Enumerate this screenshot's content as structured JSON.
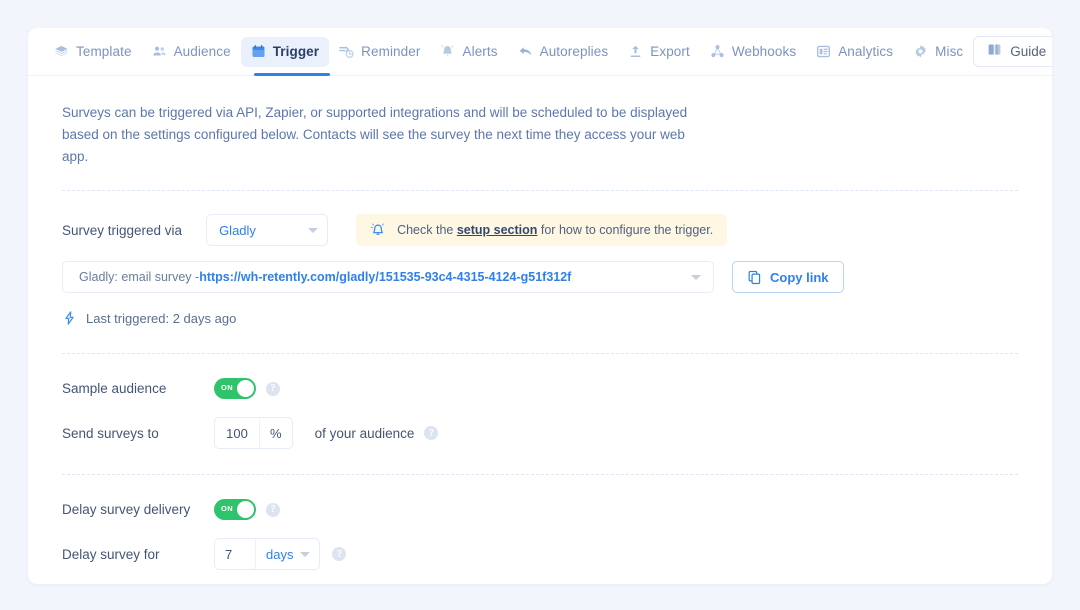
{
  "tabs": [
    {
      "label": "Template",
      "icon": "layers-icon",
      "active": false
    },
    {
      "label": "Audience",
      "icon": "people-icon",
      "active": false
    },
    {
      "label": "Trigger",
      "icon": "calendar-icon",
      "active": true
    },
    {
      "label": "Reminder",
      "icon": "clock-arrow-icon",
      "active": false
    },
    {
      "label": "Alerts",
      "icon": "bell-icon",
      "active": false
    },
    {
      "label": "Autoreplies",
      "icon": "reply-icon",
      "active": false
    },
    {
      "label": "Export",
      "icon": "upload-icon",
      "active": false
    },
    {
      "label": "Webhooks",
      "icon": "share-nodes-icon",
      "active": false
    },
    {
      "label": "Analytics",
      "icon": "report-icon",
      "active": false
    },
    {
      "label": "Misc",
      "icon": "gear-icon",
      "active": false
    }
  ],
  "guide_button": {
    "label": "Guide",
    "icon": "book-icon"
  },
  "intro": "Surveys can be triggered via API, Zapier, or supported integrations and will be scheduled to be displayed based on the settings configured below. Contacts will see the survey the next time they access your web app.",
  "trigger_via": {
    "label": "Survey triggered via",
    "value": "Gladly"
  },
  "alert": {
    "icon": "notification-bell-icon",
    "text_before": "Check the ",
    "link": "setup section",
    "text_after": " for how to configure the trigger."
  },
  "survey_link": {
    "prefix": "Gladly: email survey - ",
    "url": "https://wh-retently.com/gladly/151535-93c4-4315-4124-g51f312f",
    "copy_label": "Copy link",
    "copy_icon": "copy-icon"
  },
  "last_triggered": {
    "icon": "lightning-icon",
    "text": "Last triggered: 2 days ago"
  },
  "sample_audience": {
    "label": "Sample audience",
    "toggle_state": "ON",
    "help_icon": "question-mark-icon"
  },
  "send_surveys_to": {
    "label": "Send surveys to",
    "value": "100",
    "unit": "%",
    "suffix_label": "of your audience",
    "help_icon": "question-mark-icon"
  },
  "delay_delivery": {
    "label": "Delay survey delivery",
    "toggle_state": "ON",
    "help_icon": "question-mark-icon"
  },
  "delay_for": {
    "label": "Delay survey for",
    "value": "7",
    "unit": "days",
    "help_icon": "question-mark-icon"
  },
  "colors": {
    "accent_blue": "#2f80ed",
    "toggle_green": "#2fc36b",
    "alert_bg": "#fdf7e3",
    "page_bg": "#f2f5fc",
    "tab_active_bg": "#eaf1fd"
  }
}
